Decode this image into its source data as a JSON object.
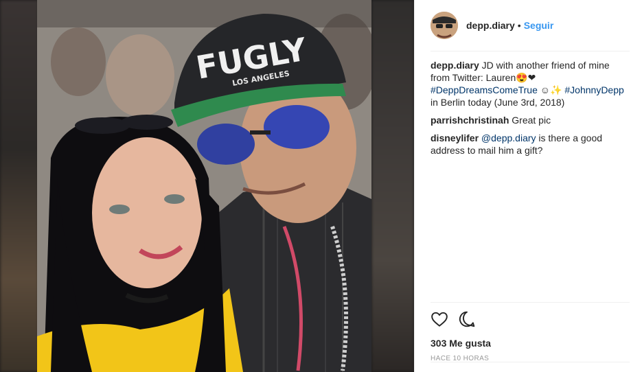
{
  "post": {
    "username": "depp.diary",
    "separator": "•",
    "follow_label": "Seguir",
    "photo_alt": "Selfie of a woman with a man in a FUGLY cap",
    "cap_text": "FUGLY",
    "cap_subtext": "LOS ANGELES"
  },
  "caption": {
    "username": "depp.diary",
    "text_1": " JD with another friend of mine from Twitter: Lauren😍❤",
    "hashtag_1": "#DeppDreamsComeTrue",
    "text_2": " ☺✨",
    "hashtag_2": "#JohnnyDepp",
    "text_3": " in Berlin today (June 3rd, 2018)"
  },
  "comments": [
    {
      "username": "parrishchristinah",
      "text": " Great pic"
    },
    {
      "username": "disneylifer",
      "mention": "@depp.diary",
      "text": " is there a good address to mail him a gift?"
    }
  ],
  "actions": {
    "like_icon": "heart-icon",
    "comment_icon": "comment-icon",
    "likes_text": "303 Me gusta",
    "time_text": "HACE 10 HORAS"
  },
  "colors": {
    "link": "#3897f0",
    "hashtag": "#003569",
    "divider": "#efefef",
    "muted": "#999999"
  }
}
